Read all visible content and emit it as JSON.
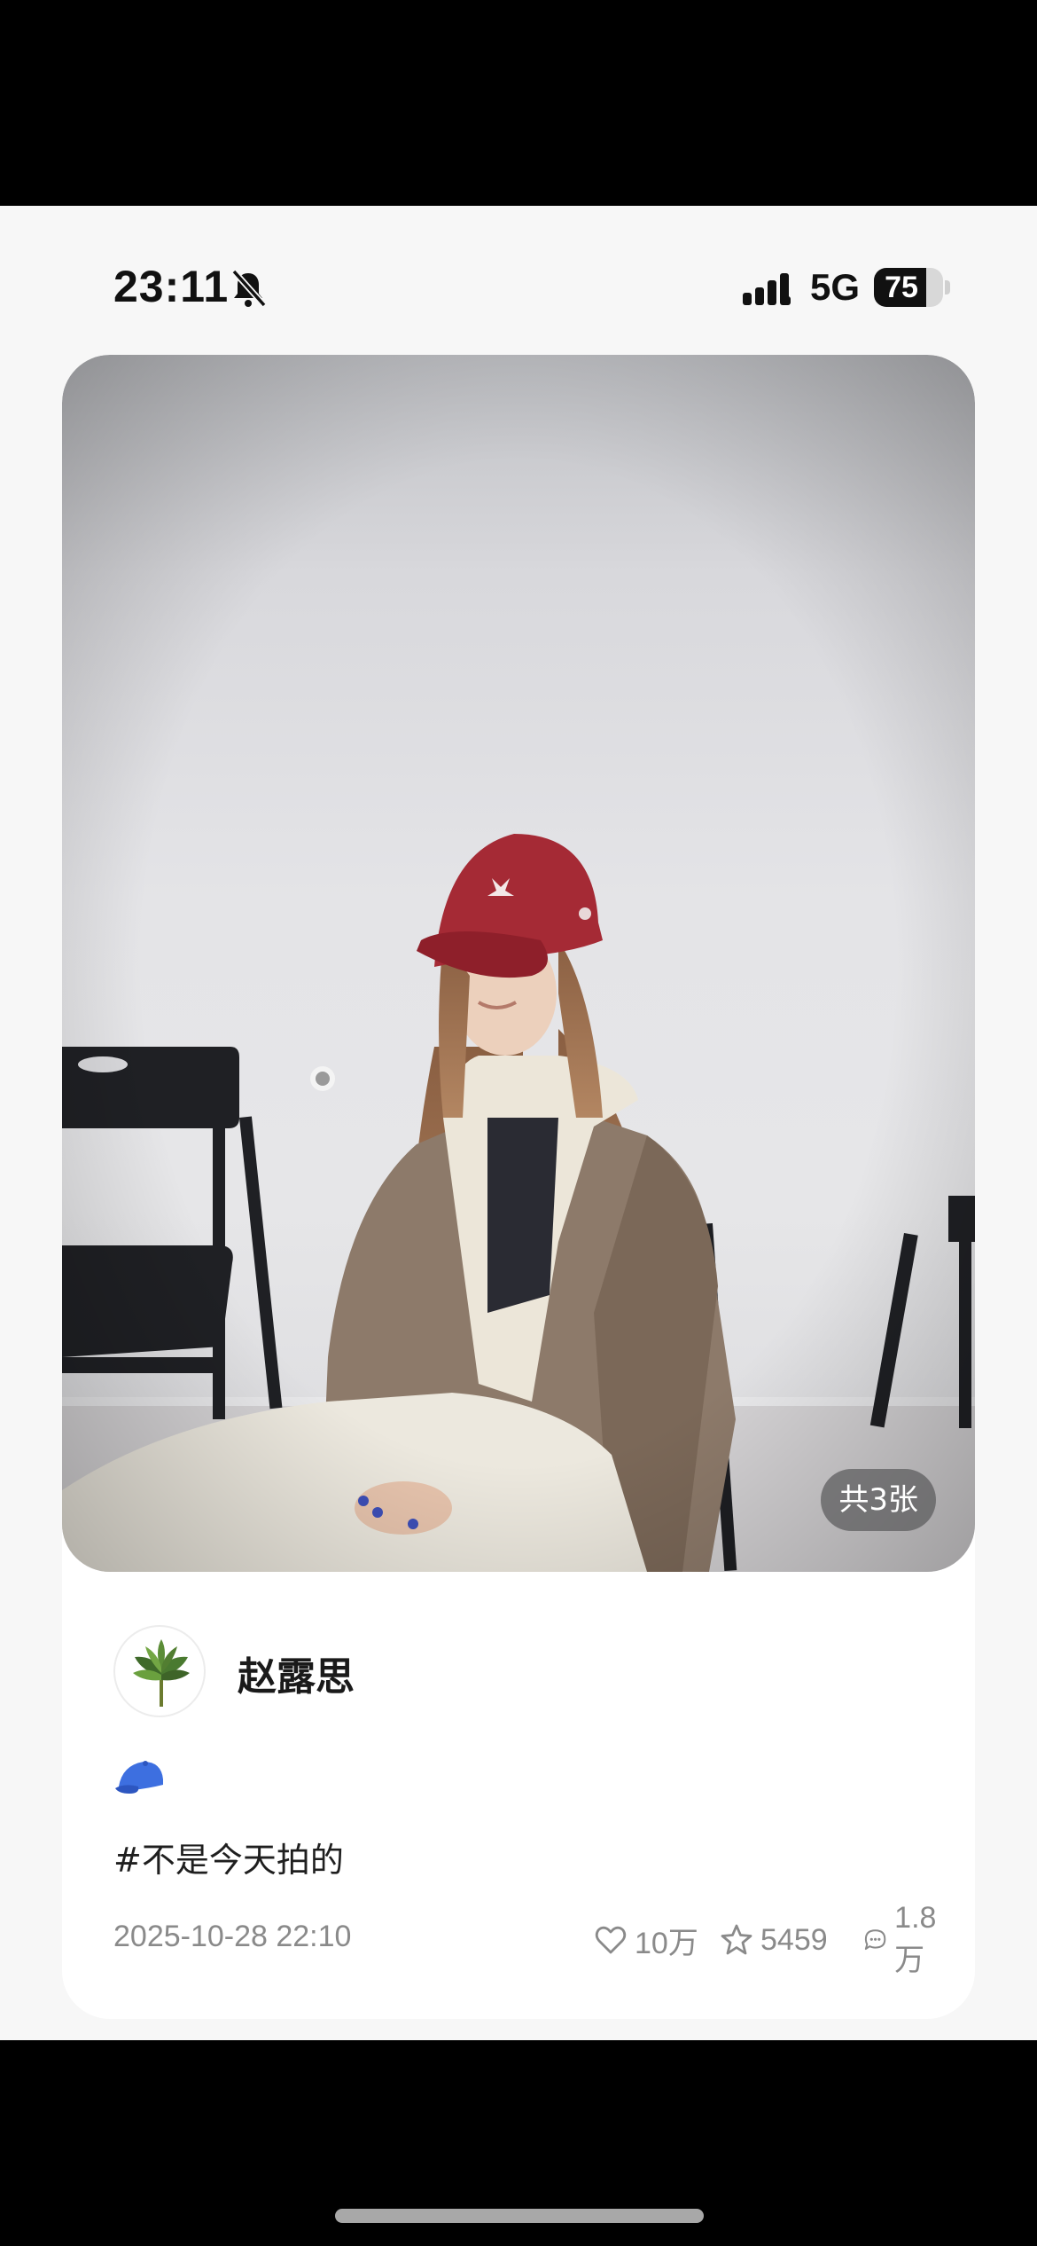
{
  "status_bar": {
    "time": "23:11",
    "network": "5G",
    "battery": "75",
    "battery_level": 0.75
  },
  "post": {
    "image_counter": "共3张",
    "author_name": "赵露思",
    "emoji": "cap-emoji",
    "text": "#不是今天拍的",
    "date": "2025-10-28 22:10",
    "stats": {
      "likes": "10万",
      "favorites": "5459",
      "comments": "1.8万"
    }
  },
  "colors": {
    "cap_red": "#a52a35",
    "muted_text": "#8a8a8a",
    "emoji_blue": "#3d6fe0"
  }
}
